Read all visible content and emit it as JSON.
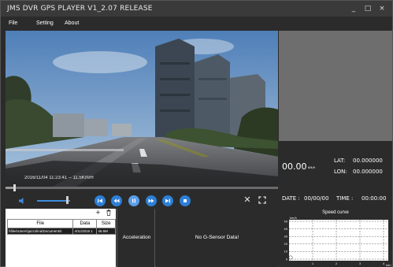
{
  "window": {
    "title": "JMS DVR GPS PLAYER V1_2.07 RELEASE",
    "minimize": "_",
    "maximize": "□",
    "close": "×"
  },
  "menu": {
    "items": [
      "File",
      "Setting",
      "About"
    ]
  },
  "video": {
    "timestamp": "2016/11/04  11:23:41 -- 11.5Km/H",
    "progress": 0.03
  },
  "controls": {
    "volume_level": 0.9,
    "icons": [
      "volume-icon",
      "skip-previous-icon",
      "rewind-icon",
      "pause-icon",
      "fast-forward-icon",
      "skip-next-icon",
      "stop-icon",
      "close-icon",
      "fullscreen-icon"
    ],
    "close_glyph": "✕",
    "accent_color": "#2d7fd6"
  },
  "file_list": {
    "add_glyph": "+",
    "columns": [
      "File",
      "Data",
      "Size"
    ],
    "rows": [
      {
        "file": "\\\\files\\Users\\jazzolina\\Documents\\",
        "data": "4/11/2016 1",
        "size": "46.5M"
      }
    ]
  },
  "panels": {
    "acceleration_label": "Acceleration",
    "gsensor_message": "No G-Sensor Data!"
  },
  "gps": {
    "speed": "00.00",
    "speed_unit": "KM/H",
    "lat_label": "LAT:",
    "lat_value": "00.000000",
    "lon_label": "LON:",
    "lon_value": "00.000000",
    "date_label": "DATE :",
    "date_value": "00/00/00",
    "time_label": "TIME :",
    "time_value": "00:00:00"
  },
  "speed_curve": {
    "title": "Speed curve",
    "y_unit": "km/h",
    "x_unit": "min",
    "y_ticks": [
      "50",
      "40",
      "30",
      "20",
      "10",
      "0"
    ],
    "x_ticks": [
      "1",
      "2",
      "3",
      "4"
    ]
  }
}
